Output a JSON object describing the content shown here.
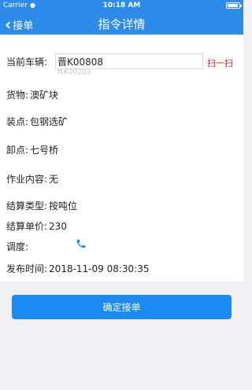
{
  "status_bar": {
    "carrier": "Carrier",
    "time": "10:18 AM",
    "battery_level": 0.9
  },
  "nav": {
    "back_label": "接单",
    "title": "指令详情"
  },
  "vehicle": {
    "label": "当前车辆:",
    "value": "晋K00808",
    "suggestion": "晋K00203",
    "scan_label": "扫一扫"
  },
  "details": {
    "cargo": {
      "label": "货物:",
      "value": "澳矿块"
    },
    "loading": {
      "label": "装点:",
      "value": "包钢选矿"
    },
    "unloading": {
      "label": "卸点:",
      "value": "七号桥"
    },
    "work": {
      "label": "作业内容:",
      "value": "无"
    },
    "settle_type": {
      "label": "结算类型:",
      "value": "按吨位"
    },
    "unit_price": {
      "label": "结算单价:",
      "value": "230"
    },
    "dispatch": {
      "label": "调度:",
      "icon": "phone-icon"
    },
    "publish_time": {
      "label": "发布时间:",
      "value": "2018-11-09 08:30:35"
    }
  },
  "confirm_label": "确定接单",
  "colors": {
    "primary": "#2e8bea",
    "button": "#1a8af5",
    "scan": "#e02020",
    "phone": "#1a8af5"
  }
}
